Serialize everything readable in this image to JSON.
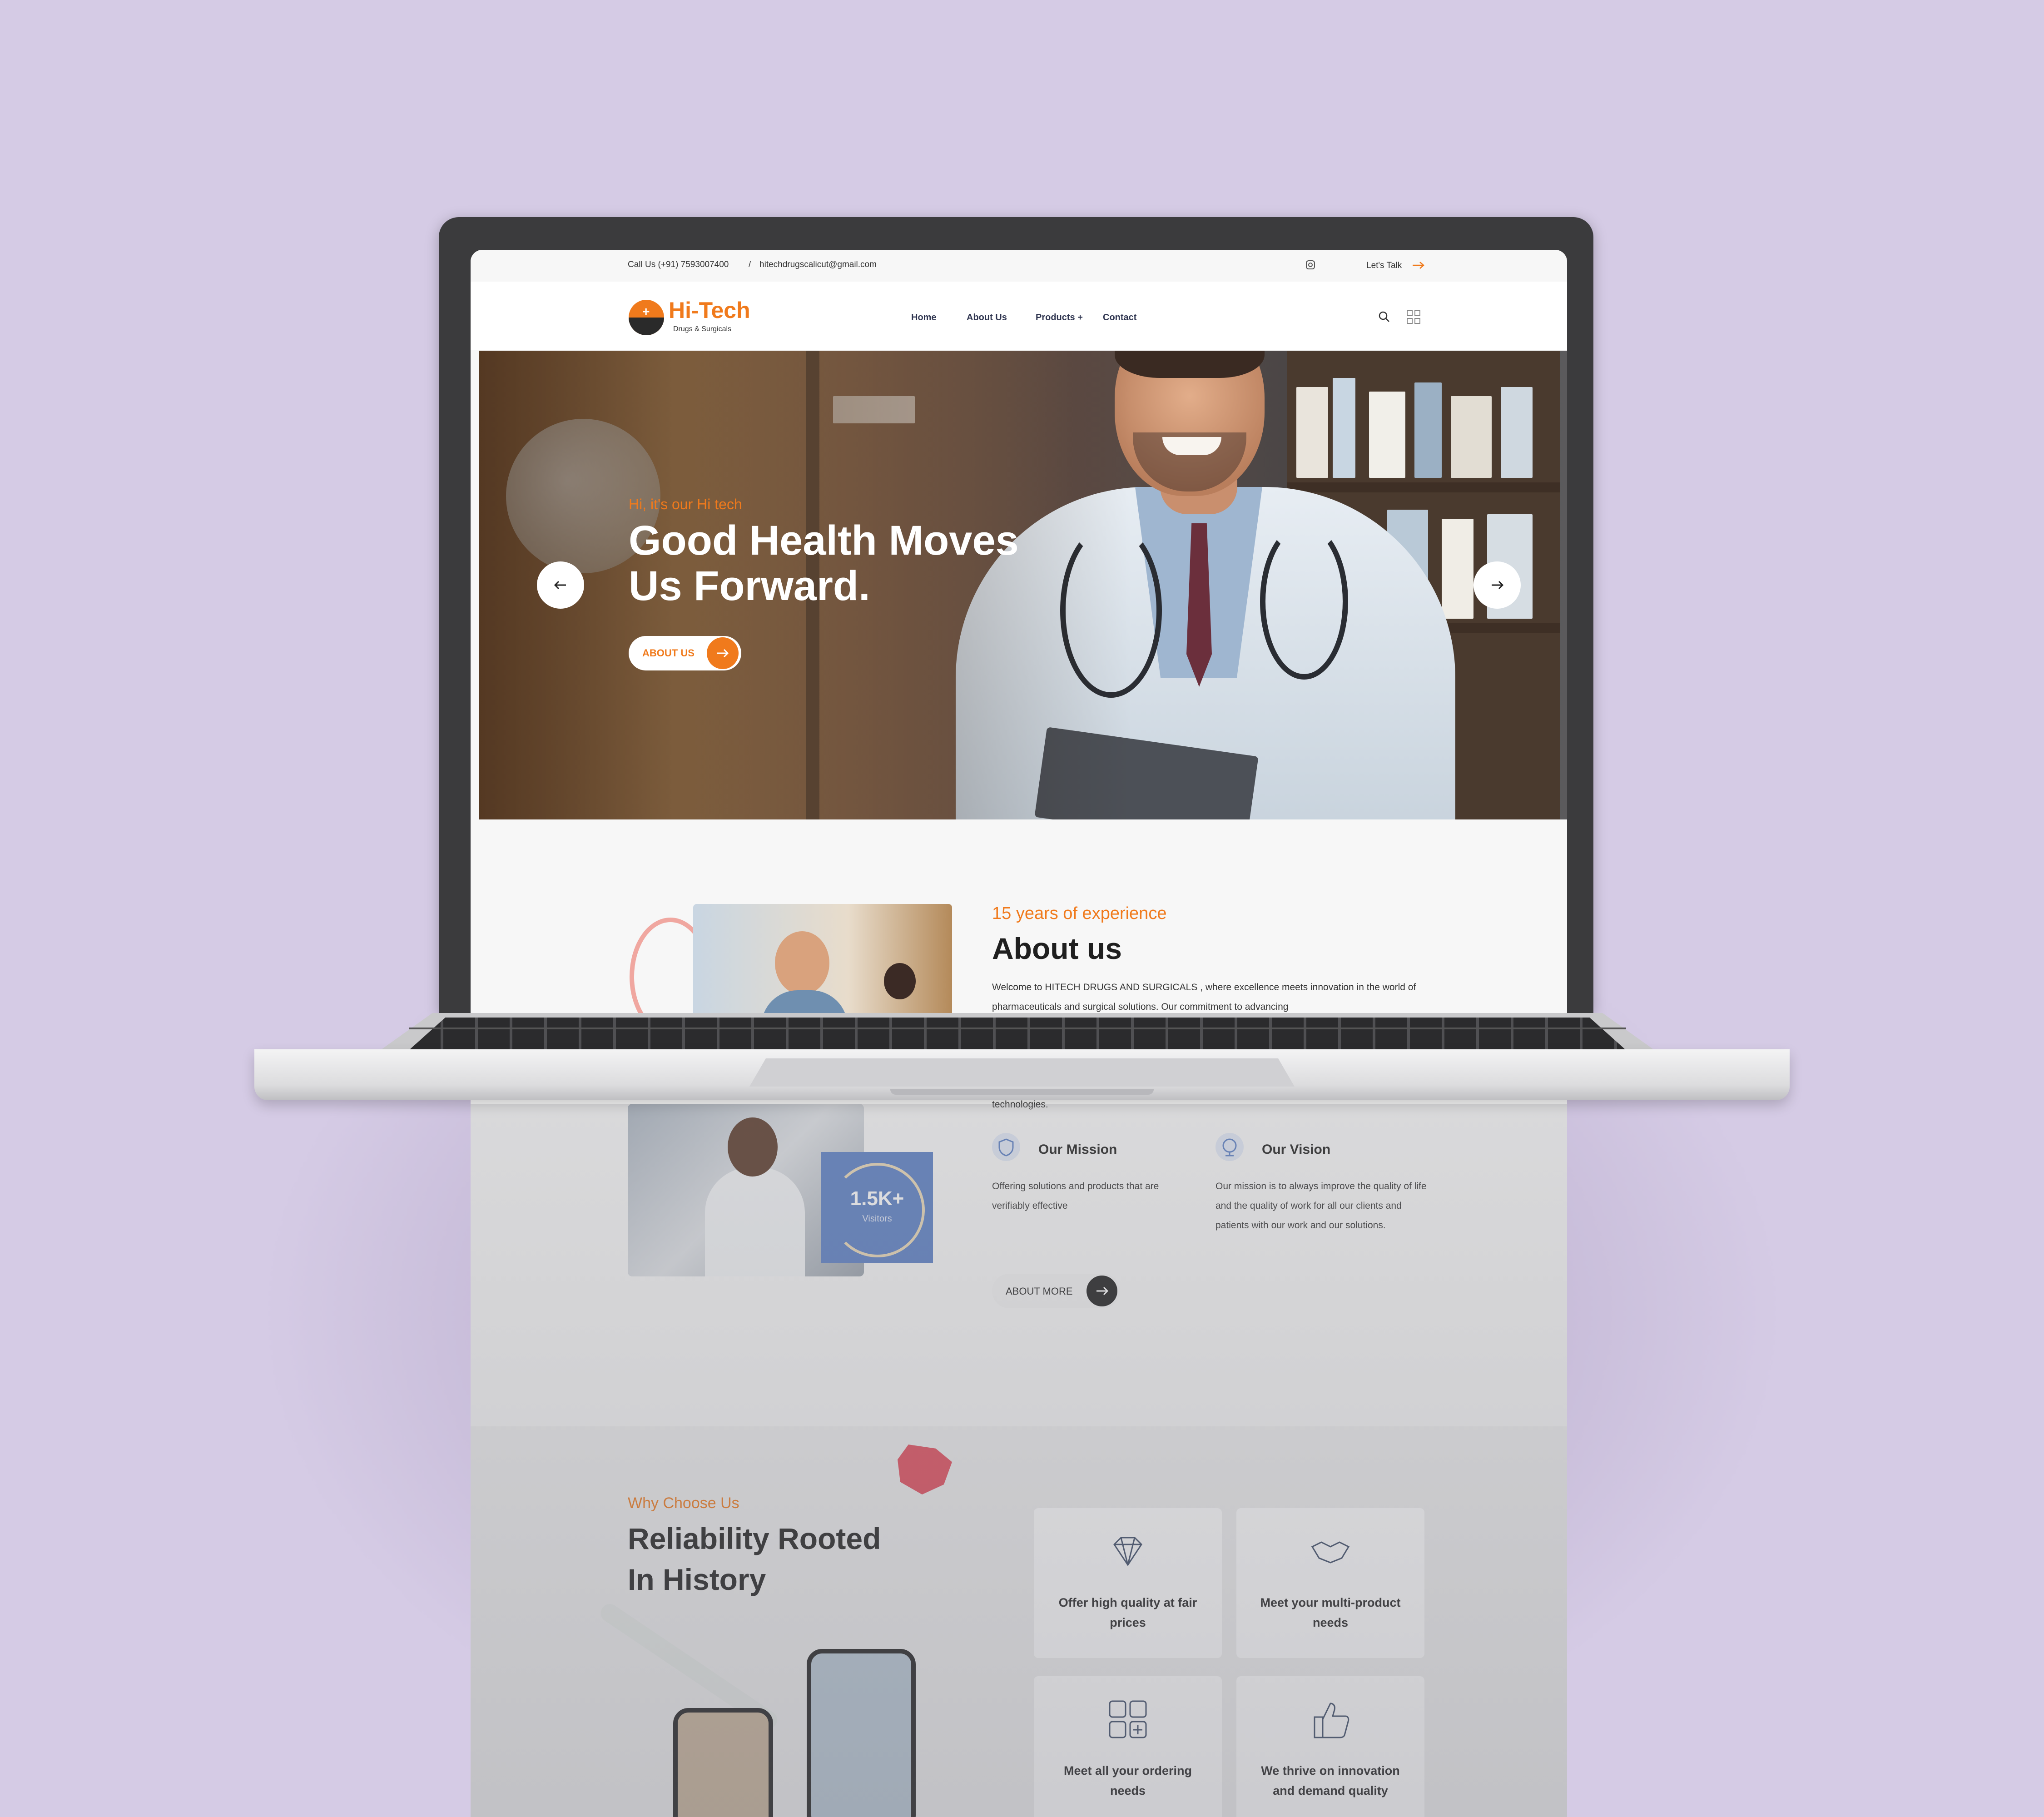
{
  "topbar": {
    "phone": "Call Us (+91) 7593007400",
    "separator": "/",
    "email": "hitechdrugscalicut@gmail.com",
    "cta_label": "Let's Talk",
    "icons": [
      "instagram-icon",
      "arrow-right-icon"
    ]
  },
  "brand": {
    "name": "Hi-Tech",
    "tagline": "Drugs & Surgicals"
  },
  "nav": {
    "items": [
      {
        "label": "Home"
      },
      {
        "label": "About Us"
      },
      {
        "label": "Products +"
      },
      {
        "label": "Contact"
      }
    ],
    "icons": [
      "search-icon",
      "grid-menu-icon"
    ]
  },
  "hero": {
    "kicker": "Hi, it's our Hi tech",
    "title": "Good Health Moves Us Forward.",
    "button_label": "ABOUT US",
    "icons": [
      "arrow-left-icon",
      "arrow-right-icon"
    ]
  },
  "about": {
    "kicker": "15 years of experience",
    "title": "About us",
    "text": "Welcome to HITECH DRUGS AND SURGICALS , where excellence meets innovation in the world of pharmaceuticals and surgical solutions. Our commitment to advancing",
    "text_tail": "technologies.",
    "visitors_value": "1.5K+",
    "visitors_label": "Visitors",
    "mission_title": "Our Mission",
    "mission_text": "Offering solutions and products that are verifiably effective",
    "vision_title": "Our Vision",
    "vision_text": "Our mission is to always improve the quality of life and the quality of work for all our clients and patients with our work and our solutions.",
    "button_label": "ABOUT MORE"
  },
  "why": {
    "kicker": "Why Choose Us",
    "title": "Reliability Rooted In History",
    "features": [
      {
        "label": "Offer high quality at fair prices",
        "icon": "diamond-icon"
      },
      {
        "label": "Meet your multi-product needs",
        "icon": "handshake-icon"
      },
      {
        "label": "Meet all your ordering needs",
        "icon": "apps-grid-icon"
      },
      {
        "label": "We thrive on innovation and demand quality",
        "icon": "thumbs-up-icon"
      }
    ]
  },
  "colors": {
    "accent": "#f07a1c",
    "background": "#d5cbe5",
    "visitors_card": "#5b7fc4"
  }
}
